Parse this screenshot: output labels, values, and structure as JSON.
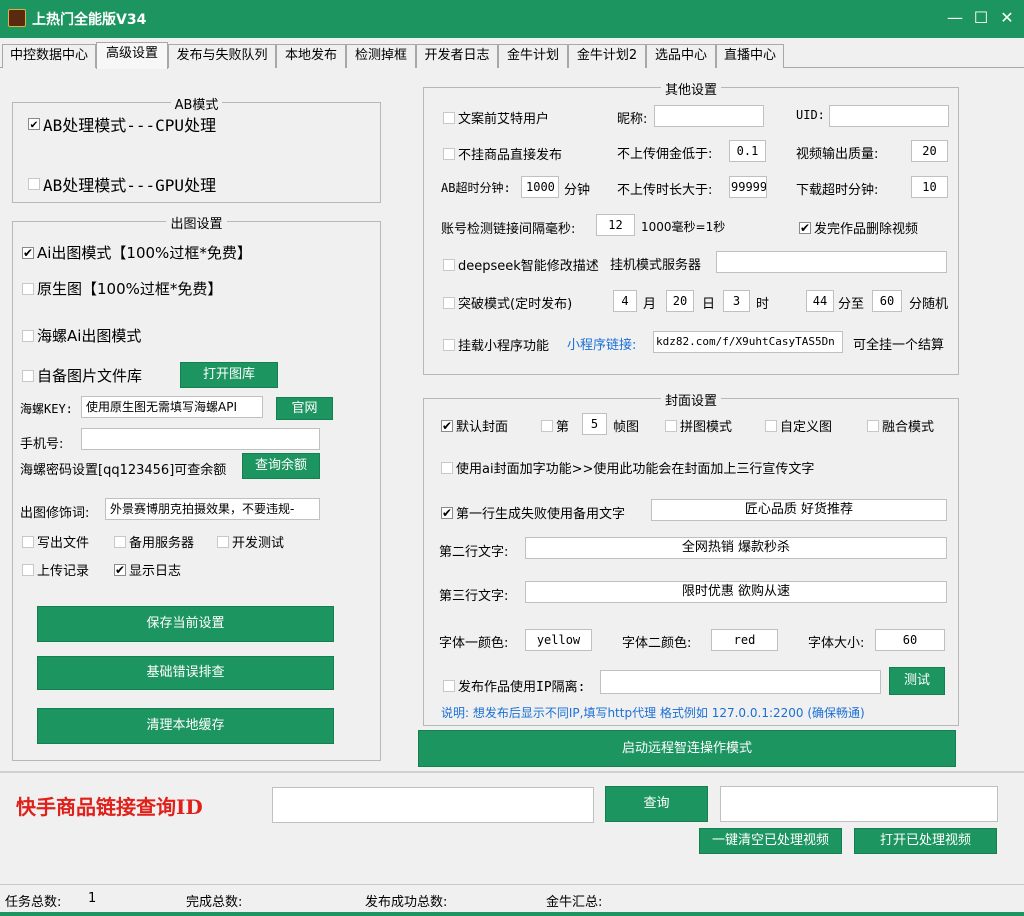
{
  "window": {
    "title": "上热门全能版V34",
    "controls": {
      "minimize": "—",
      "maximize": "☐",
      "close": "✕"
    },
    "accent_color": "#1d9560"
  },
  "tabs": [
    {
      "label": "中控数据中心"
    },
    {
      "label": "高级设置",
      "active": true
    },
    {
      "label": "发布与失败队列"
    },
    {
      "label": "本地发布"
    },
    {
      "label": "检测掉框"
    },
    {
      "label": "开发者日志"
    },
    {
      "label": "金牛计划"
    },
    {
      "label": "金牛计划2"
    },
    {
      "label": "选品中心"
    },
    {
      "label": "直播中心"
    }
  ],
  "ab_mode": {
    "title": "AB模式",
    "cpu": {
      "label": "AB处理模式---CPU处理",
      "checked": true
    },
    "gpu": {
      "label": "AB处理模式---GPU处理",
      "checked": false
    }
  },
  "image_settings": {
    "title": "出图设置",
    "ai_mode": {
      "label": "Ai出图模式【100%过框*免费】",
      "checked": true
    },
    "original": {
      "label": "原生图【100%过框*免费】",
      "checked": false
    },
    "hailuo_ai": {
      "label": "海螺Ai出图模式",
      "checked": false
    },
    "own_library": {
      "label": "自备图片文件库",
      "checked": false
    },
    "open_library_button": "打开图库",
    "key_label": "海螺KEY:",
    "key_value": "使用原生图无需填写海螺API",
    "official_button": "官网",
    "phone_label": "手机号:",
    "phone_value": "",
    "password_label": "海螺密码设置[qq123456]可查余额",
    "check_balance_button": "查询余额",
    "modifier_label": "出图修饰词:",
    "modifier_value": "外景赛博朋克拍摄效果，不要违规-",
    "write_file": {
      "label": "写出文件",
      "checked": false
    },
    "backup_server": {
      "label": "备用服务器",
      "checked": false
    },
    "dev_test": {
      "label": "开发测试",
      "checked": false
    },
    "upload_record": {
      "label": "上传记录",
      "checked": false
    },
    "show_log": {
      "label": "显示日志",
      "checked": true
    },
    "save_button": "保存当前设置",
    "basic_check_button": "基础错误排查",
    "clear_cache_button": "清理本地缓存"
  },
  "other_settings": {
    "title": "其他设置",
    "ai_mention": {
      "label": "文案前艾特用户",
      "checked": false
    },
    "nickname_label": "昵称:",
    "nickname_value": "",
    "uid_label": "UID:",
    "uid_value": "",
    "no_product": {
      "label": "不挂商品直接发布",
      "checked": false
    },
    "commission_label": "不上传佣金低于:",
    "commission_value": "0.1",
    "quality_label": "视频输出质量:",
    "quality_value": "20",
    "ab_timeout_label": "AB超时分钟:",
    "ab_timeout_value": "1000",
    "ab_timeout_unit": "分钟",
    "max_duration_label": "不上传时长大于:",
    "max_duration_value": "99999",
    "download_timeout_label": "下载超时分钟:",
    "download_timeout_value": "10",
    "interval_label": "账号检测链接间隔毫秒:",
    "interval_value": "12",
    "interval_note": "1000毫秒=1秒",
    "delete_after_post": {
      "label": "发完作品删除视频",
      "checked": true
    },
    "deepseek": {
      "label": "deepseek智能修改描述",
      "checked": false
    },
    "server_label": "挂机模式服务器",
    "server_value": "",
    "breakthrough": {
      "label": "突破模式(定时发布)",
      "checked": false
    },
    "month_value": "4",
    "month_label": "月",
    "day_value": "20",
    "day_label": "日",
    "hour_value": "3",
    "hour_label": "时",
    "min_from_value": "44",
    "min_to_label": "分至",
    "min_to_value": "60",
    "random_label": "分随机",
    "mini_program": {
      "label": "挂载小程序功能",
      "checked": false
    },
    "mini_link_label": "小程序链接:",
    "mini_link_value": "kdz82.com/f/X9uhtCasyTAS5Dn",
    "mini_note": "可全挂一个结算"
  },
  "cover_settings": {
    "title": "封面设置",
    "default_cover": {
      "label": "默认封面",
      "checked": true
    },
    "nth_frame": {
      "label": "第",
      "checked": false
    },
    "frame_value": "5",
    "frame_unit": "帧图",
    "collage": {
      "label": "拼图模式",
      "checked": false
    },
    "custom": {
      "label": "自定义图",
      "checked": false
    },
    "blend": {
      "label": "融合模式",
      "checked": false
    },
    "ai_text": {
      "label": "使用ai封面加字功能>>使用此功能会在封面加上三行宣传文字",
      "checked": false
    },
    "fallback_first": {
      "label": "第一行生成失败使用备用文字",
      "checked": true
    },
    "line1_value": "匠心品质 好货推荐",
    "line2_label": "第二行文字:",
    "line2_value": "全网热销 爆款秒杀",
    "line3_label": "第三行文字:",
    "line3_value": "限时优惠 欲购从速",
    "color1_label": "字体一颜色:",
    "color1_value": "yellow",
    "color2_label": "字体二颜色:",
    "color2_value": "red",
    "font_size_label": "字体大小:",
    "font_size_value": "60",
    "ip_isolation": {
      "label": "发布作品使用IP隔离:",
      "checked": false
    },
    "ip_value": "",
    "test_button": "测试",
    "note": "说明: 想发布后显示不同IP,填写http代理  格式例如 127.0.0.1:2200 (确保畅通)"
  },
  "remote_button": "启动远程智连操作模式",
  "query": {
    "title": "快手商品链接查询ID",
    "input_value": "",
    "button": "查询",
    "result_value": "",
    "clear_button": "一键清空已处理视频",
    "open_button": "打开已处理视频"
  },
  "status": {
    "task_total_label": "任务总数:",
    "task_total_value": "1",
    "done_total_label": "完成总数:",
    "done_total_value": "",
    "success_total_label": "发布成功总数:",
    "success_total_value": "",
    "jinniu_label": "金牛汇总:",
    "jinniu_value": ""
  }
}
